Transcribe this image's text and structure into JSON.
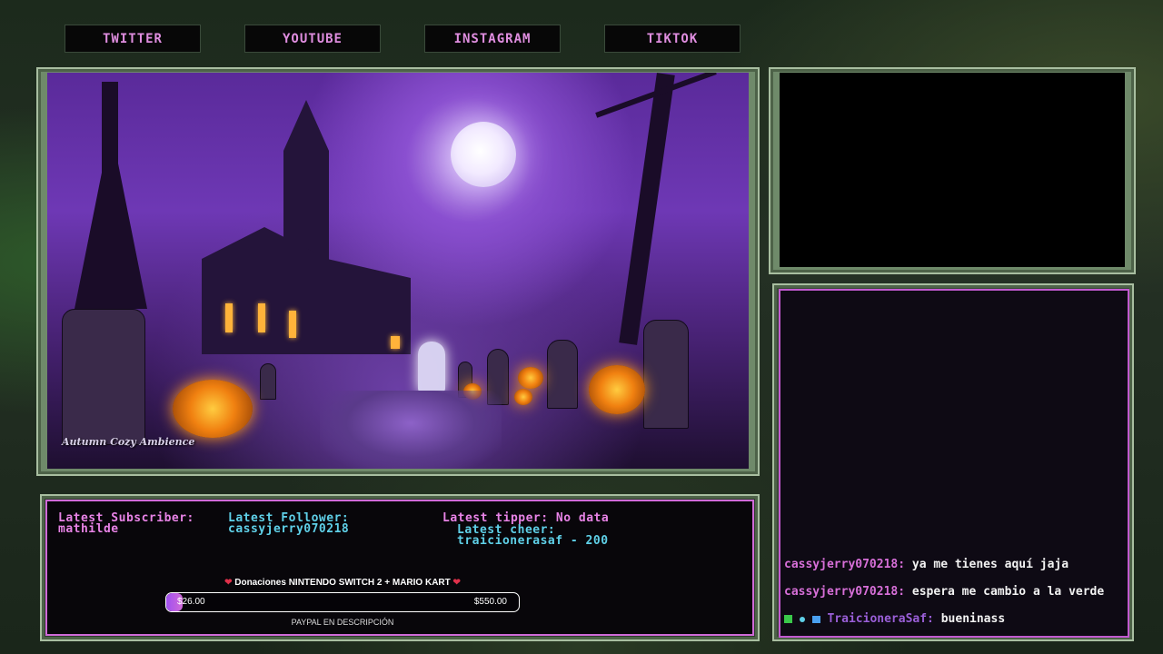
{
  "social": {
    "twitter": "TWITTER",
    "youtube": "YOUTUBE",
    "instagram": "INSTAGRAM",
    "tiktok": "TIKTOK"
  },
  "scene": {
    "watermark": "Autumn Cozy Ambience"
  },
  "stats": {
    "subscriber_label": "Latest Subscriber:",
    "subscriber_value": "mathilde",
    "follower_label": "Latest Follower:",
    "follower_value": "cassyjerry070218",
    "tipper_line": "Latest tipper: No data",
    "cheer_label": "Latest cheer:",
    "cheer_value": "traicionerasaf - 200"
  },
  "donation": {
    "title": "Donaciones NINTENDO SWITCH 2 + MARIO KART",
    "current": "$26.00",
    "goal": "$550.00",
    "progress": 0.047,
    "footer": "PAYPAL EN DESCRIPCIÓN"
  },
  "chat": {
    "messages": [
      {
        "user": "cassyjerry070218:",
        "text": "ya me tienes aquí jaja"
      },
      {
        "user": "cassyjerry070218:",
        "text": "espera me cambio a la verde"
      },
      {
        "user": "TraicioneraSaf:",
        "text": "bueninass"
      }
    ]
  },
  "colors": {
    "accent_pink": "#e883e6",
    "accent_cyan": "#5fd0e8",
    "frame_green": "#6f8a6a"
  }
}
